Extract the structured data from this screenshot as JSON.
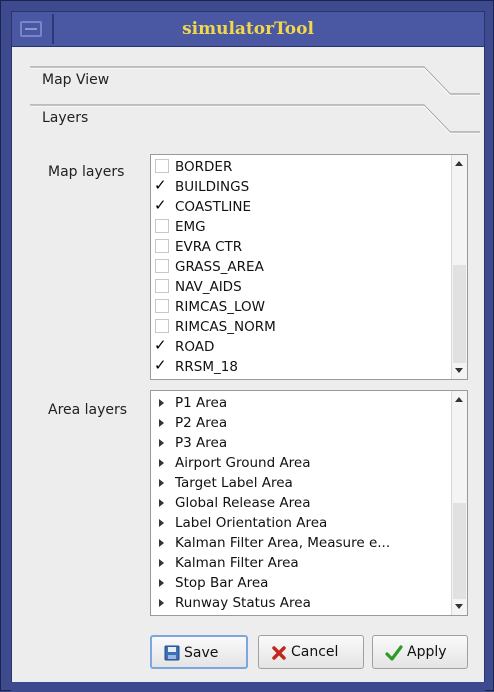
{
  "window": {
    "title": "simulatorTool"
  },
  "accordion": {
    "sections": [
      {
        "label": "Map View"
      },
      {
        "label": "Layers"
      }
    ]
  },
  "map_layers": {
    "label": "Map layers",
    "items": [
      {
        "label": "BORDER",
        "checked": false
      },
      {
        "label": "BUILDINGS",
        "checked": true
      },
      {
        "label": "COASTLINE",
        "checked": true
      },
      {
        "label": "EMG",
        "checked": false
      },
      {
        "label": "EVRA CTR",
        "checked": false
      },
      {
        "label": "GRASS_AREA",
        "checked": false
      },
      {
        "label": "NAV_AIDS",
        "checked": false
      },
      {
        "label": "RIMCAS_LOW",
        "checked": false
      },
      {
        "label": "RIMCAS_NORM",
        "checked": false
      },
      {
        "label": "ROAD",
        "checked": true
      },
      {
        "label": "RRSM_18",
        "checked": true
      }
    ],
    "check_glyph": "✓"
  },
  "area_layers": {
    "label": "Area layers",
    "items": [
      {
        "label": "P1 Area"
      },
      {
        "label": "P2 Area"
      },
      {
        "label": "P3 Area"
      },
      {
        "label": "Airport Ground Area"
      },
      {
        "label": "Target Label Area"
      },
      {
        "label": "Global Release Area"
      },
      {
        "label": "Label Orientation Area"
      },
      {
        "label": "Kalman Filter Area, Measure e..."
      },
      {
        "label": "Kalman Filter Area"
      },
      {
        "label": "Stop Bar Area"
      },
      {
        "label": "Runway Status Area"
      }
    ]
  },
  "buttons": {
    "save": {
      "label": "Save",
      "icon": "floppy-icon"
    },
    "cancel": {
      "label": "Cancel",
      "icon": "red-x-icon"
    },
    "apply": {
      "label": "Apply",
      "icon": "green-check-icon"
    }
  },
  "colors": {
    "title_text": "#f0d84a",
    "frame": "#3e4a8e",
    "client_bg": "#ededed"
  }
}
